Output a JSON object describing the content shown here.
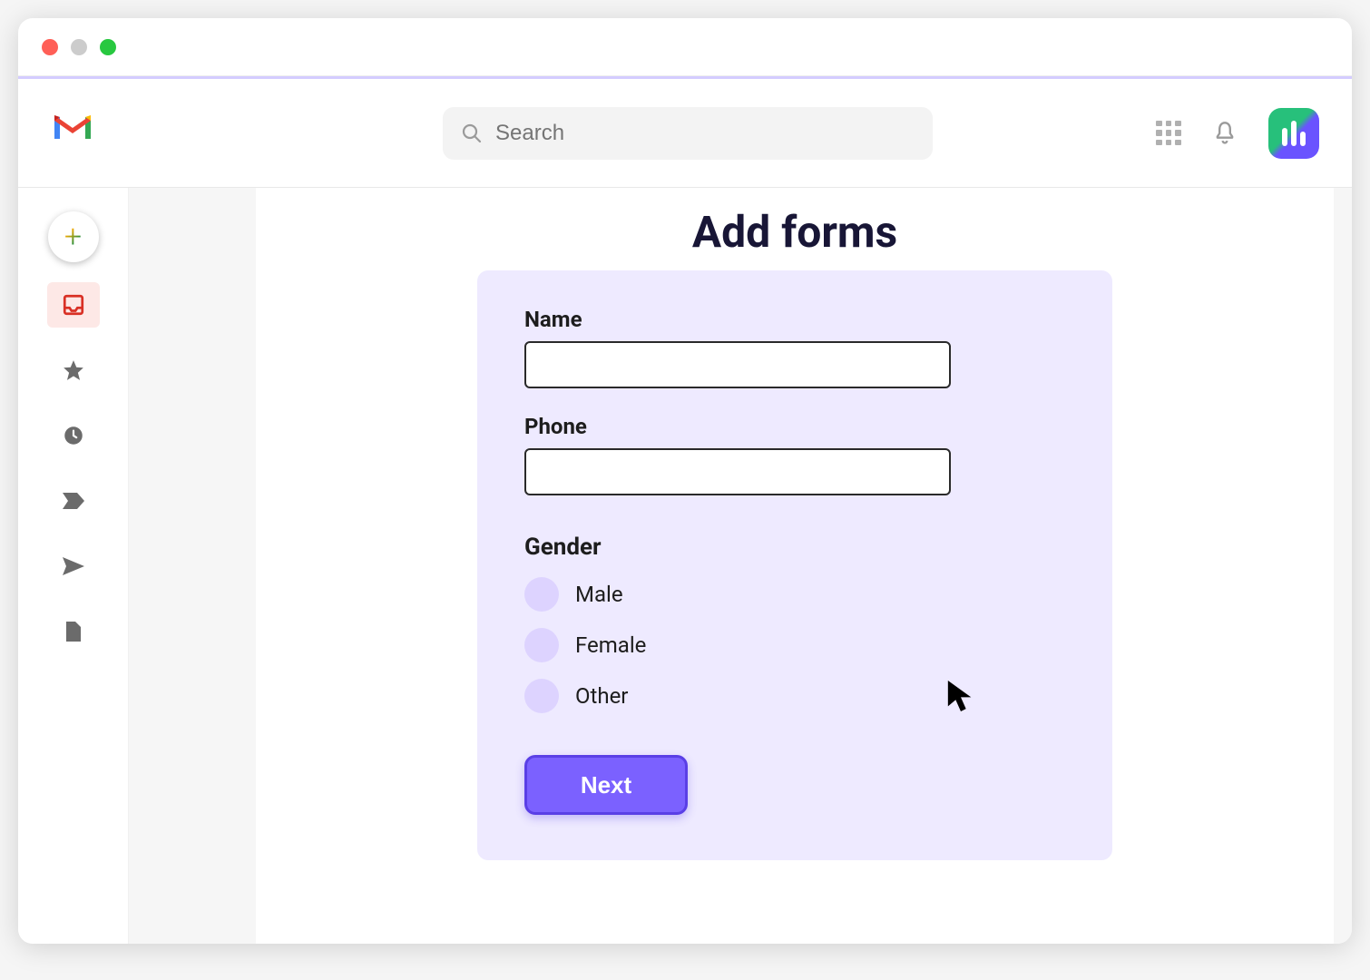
{
  "search": {
    "placeholder": "Search"
  },
  "page": {
    "title": "Add forms"
  },
  "form": {
    "name_label": "Name",
    "name_value": "",
    "phone_label": "Phone",
    "phone_value": "",
    "gender_label": "Gender",
    "gender_options": {
      "male": "Male",
      "female": "Female",
      "other": "Other"
    },
    "next_label": "Next"
  }
}
